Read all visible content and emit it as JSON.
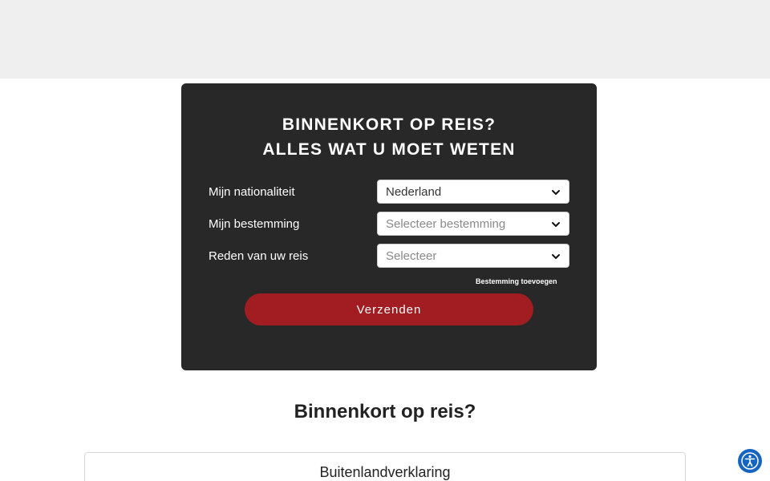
{
  "form": {
    "title_line1": "BINNENKORT OP REIS?",
    "title_line2": "ALLES WAT U MOET WETEN",
    "nationality": {
      "label": "Mijn nationaliteit",
      "value": "Nederland"
    },
    "destination": {
      "label": "Mijn bestemming",
      "placeholder": "Selecteer bestemming"
    },
    "reason": {
      "label": "Reden van uw reis",
      "placeholder": "Selecteer"
    },
    "add_destination": "Bestemming toevoegen",
    "submit_label": "Verzenden"
  },
  "section": {
    "heading": "Binnenkort op reis?",
    "card_title": "Buitenlandverklaring"
  },
  "colors": {
    "card_bg": "#282828",
    "submit_bg": "#a11d21",
    "accessibility": "#1565c0"
  },
  "icons": {
    "select_chevron": "chevron-down-icon",
    "accessibility": "accessibility-icon"
  }
}
